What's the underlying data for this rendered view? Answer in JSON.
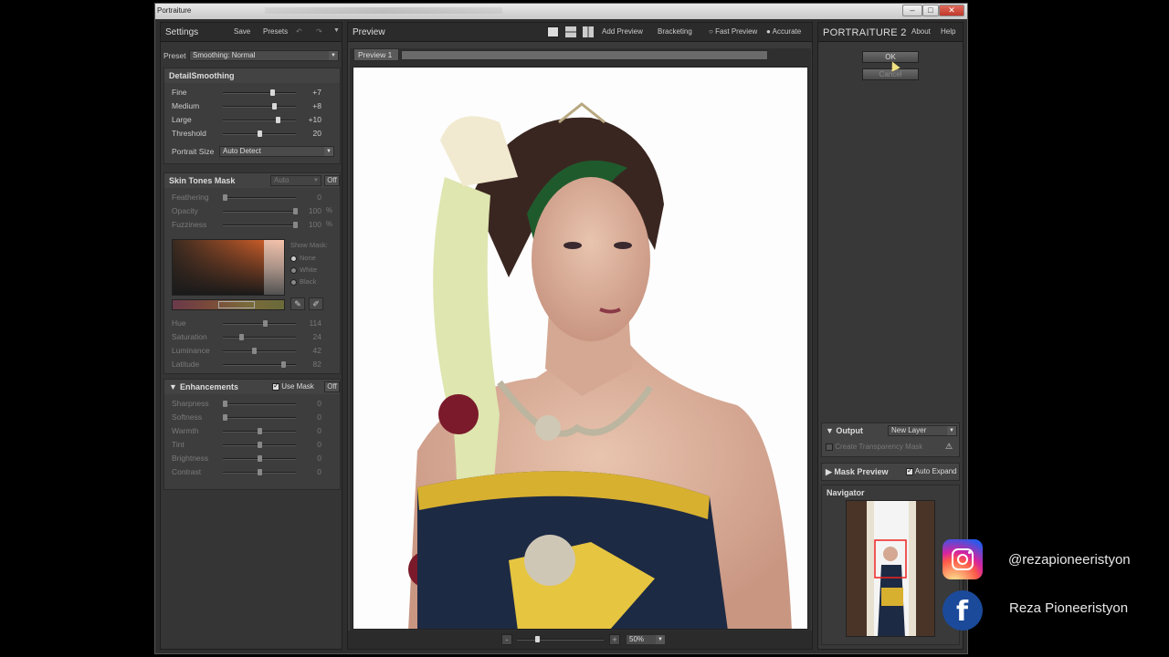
{
  "window": {
    "title": "Portraiture"
  },
  "settings": {
    "title": "Settings",
    "save": "Save",
    "presets": "Presets",
    "preset_label": "Preset",
    "preset_value": "Smoothing: Normal"
  },
  "detail": {
    "title": "DetailSmoothing",
    "sliders": [
      {
        "label": "Fine",
        "value": "+7"
      },
      {
        "label": "Medium",
        "value": "+8"
      },
      {
        "label": "Large",
        "value": "+10"
      },
      {
        "label": "Threshold",
        "value": "20"
      }
    ],
    "portrait_size_label": "Portrait Size",
    "portrait_size_value": "Auto Detect"
  },
  "skin": {
    "title": "Skin Tones Mask",
    "mode": "Auto",
    "off": "Off",
    "sliders": [
      {
        "label": "Feathering",
        "value": "0",
        "unit": ""
      },
      {
        "label": "Opacity",
        "value": "100",
        "unit": "%"
      },
      {
        "label": "Fuzziness",
        "value": "100",
        "unit": "%"
      }
    ],
    "show_mask": "Show Mask:",
    "mask_options": [
      "None",
      "White",
      "Black"
    ],
    "hsl": [
      {
        "label": "Hue",
        "value": "114"
      },
      {
        "label": "Saturation",
        "value": "24"
      },
      {
        "label": "Luminance",
        "value": "42"
      },
      {
        "label": "Latitude",
        "value": "82"
      }
    ]
  },
  "enhance": {
    "title": "Enhancements",
    "use_mask": "Use Mask",
    "off": "Off",
    "sliders": [
      {
        "label": "Sharpness",
        "value": "0"
      },
      {
        "label": "Softness",
        "value": "0"
      },
      {
        "label": "Warmth",
        "value": "0"
      },
      {
        "label": "Tint",
        "value": "0"
      },
      {
        "label": "Brightness",
        "value": "0"
      },
      {
        "label": "Contrast",
        "value": "0"
      }
    ]
  },
  "preview": {
    "title": "Preview",
    "add_preview": "Add Preview",
    "bracketing": "Bracketing",
    "fast_preview": "Fast Preview",
    "accurate": "Accurate",
    "tab": "Preview 1",
    "zoom": "50%"
  },
  "right": {
    "brand": "PORTRAITURE 2",
    "about": "About",
    "help": "Help",
    "ok": "OK",
    "cancel": "Cancel",
    "output_title": "Output",
    "output_value": "New Layer",
    "transparency": "Create Transparency Mask",
    "mask_preview": "Mask Preview",
    "auto_expand": "Auto Expand",
    "navigator": "Navigator"
  },
  "social": {
    "instagram": "@rezapioneeristyon",
    "facebook": "Reza Pioneeristyon"
  },
  "colors": {
    "panel": "#353535",
    "instagram": "#d6249f",
    "facebook": "#1877f2"
  }
}
